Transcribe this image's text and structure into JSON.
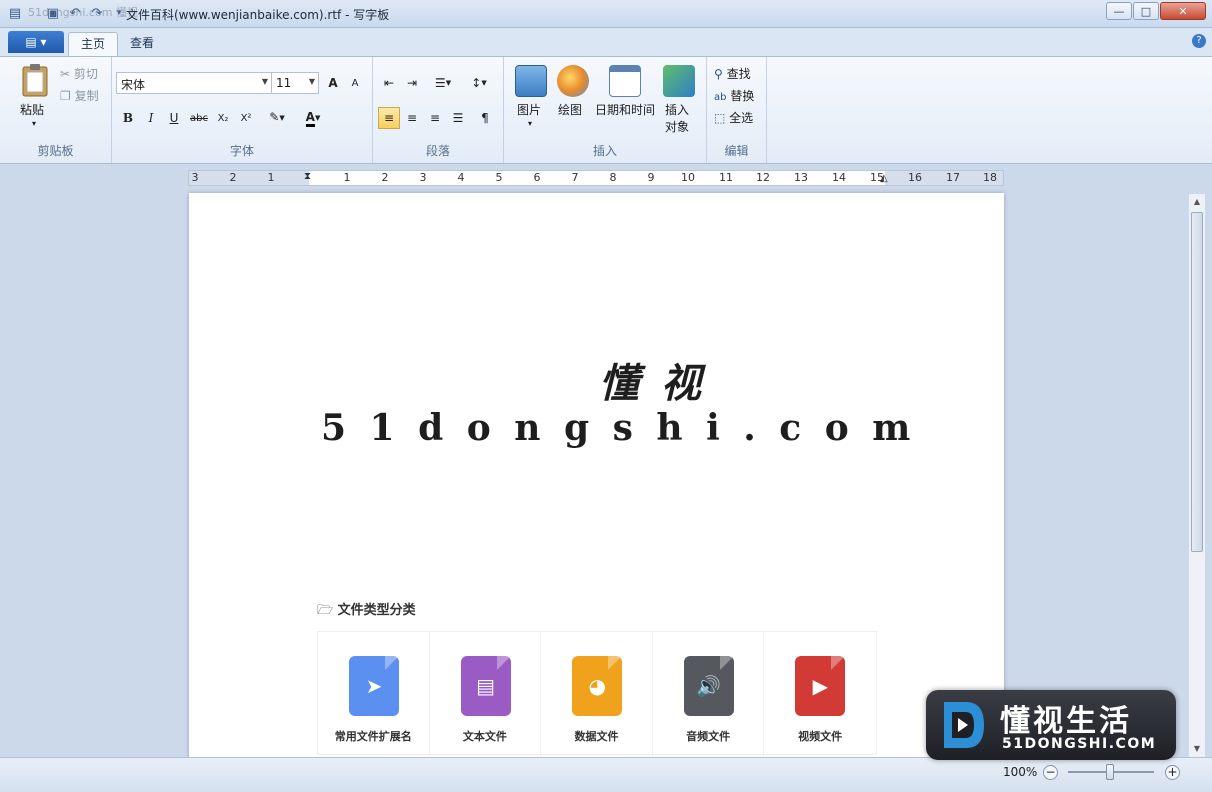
{
  "window": {
    "title": "文件百科(www.wenjianbaike.com).rtf - 写字板",
    "watermark": "51dongshi.com 懂视",
    "controls": {
      "minimize": "—",
      "maximize": "□",
      "close": "✕"
    }
  },
  "tabs": [
    {
      "label": "主页",
      "active": true
    },
    {
      "label": "查看",
      "active": false
    }
  ],
  "ribbon": {
    "clipboard": {
      "group_label": "剪贴板",
      "paste": "粘贴",
      "cut": "剪切",
      "copy": "复制"
    },
    "font": {
      "group_label": "字体",
      "font_name": "宋体",
      "font_size": "11",
      "grow": "A",
      "shrink": "A",
      "bold": "B",
      "italic": "I",
      "underline": "U",
      "strike": "abc",
      "subscript": "X₂",
      "superscript": "X²"
    },
    "paragraph": {
      "group_label": "段落"
    },
    "insert": {
      "group_label": "插入",
      "picture": "图片",
      "paint": "绘图",
      "datetime": "日期和时间",
      "object_line1": "插入",
      "object_line2": "对象"
    },
    "editing": {
      "group_label": "编辑",
      "find": "查找",
      "replace": "替换",
      "select_all": "全选"
    }
  },
  "ruler": {
    "labels": [
      "3",
      "2",
      "1",
      "1",
      "2",
      "3",
      "4",
      "5",
      "6",
      "7",
      "8",
      "9",
      "10",
      "11",
      "12",
      "13",
      "14",
      "15",
      "16",
      "17",
      "18"
    ]
  },
  "document": {
    "logo_cn": "懂视",
    "logo_en": "51dongshi.com",
    "category_title": "文件类型分类",
    "cards": [
      {
        "label": "常用文件扩展名",
        "color": "#5b8ff0",
        "icon": "cursor-arrow-icon"
      },
      {
        "label": "文本文件",
        "color": "#9a5bc4",
        "icon": "document-icon"
      },
      {
        "label": "数据文件",
        "color": "#f0a21c",
        "icon": "pie-chart-icon"
      },
      {
        "label": "音频文件",
        "color": "#55595f",
        "icon": "speaker-icon"
      },
      {
        "label": "视频文件",
        "color": "#d23a35",
        "icon": "film-icon"
      }
    ]
  },
  "status": {
    "zoom": "100%",
    "zoom_out": "−",
    "zoom_in": "+"
  },
  "brand": {
    "name_cn": "懂视生活",
    "name_en": "51DONGSHI.COM"
  }
}
